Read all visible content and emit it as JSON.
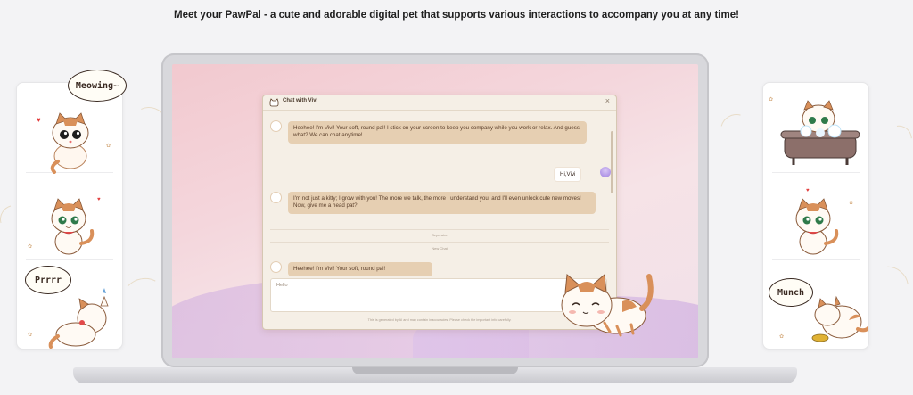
{
  "headline": "Meet your PawPal - a cute and adorable digital pet that supports various interactions to accompany you at any time!",
  "left_card": {
    "bubbles": [
      "Meowing~",
      "Prrrr"
    ]
  },
  "right_card": {
    "bubbles": [
      "Munch"
    ]
  },
  "chat": {
    "title": "Chat with Vivi",
    "close_icon": "×",
    "messages": [
      {
        "role": "pet",
        "text": "Heehee! I'm Vivi! Your soft, round pal! I stick on your screen to keep you company while you work or relax. And guess what? We can chat anytime!"
      },
      {
        "role": "user",
        "text": "Hi,Vivi"
      },
      {
        "role": "pet",
        "text": "I'm not just a kitty; I grow with you! The more we talk, the more I understand you, and I'll even unlock cute new moves! Now, give me a head pat?"
      },
      {
        "role": "pet",
        "text": "Heehee! I'm Vivi! Your soft, round pal!"
      }
    ],
    "divider_1": "Separator",
    "divider_2": "New Chat",
    "input_value": "Hello",
    "disclaimer": "This is generated by AI and may contain inaccuracies. Please check the important info carefully."
  },
  "colors": {
    "accent": "#e6cfb2",
    "cat_orange": "#d9905a",
    "heart": "#e23b3b"
  }
}
